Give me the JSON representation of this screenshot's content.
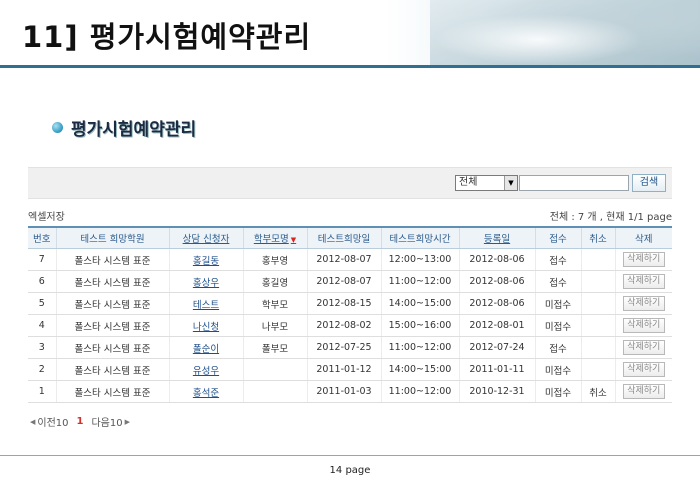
{
  "slide": {
    "title": "11] 평가시험예약관리",
    "section_title": "평가시험예약관리",
    "footer": "14 page"
  },
  "search": {
    "select_value": "전체",
    "input_value": "",
    "button_label": "검색"
  },
  "meta": {
    "excel_label": "엑셀저장",
    "summary": "전체 : 7 개  ,  현재 1/1 page"
  },
  "table": {
    "headers": [
      "번호",
      "테스트 희망학원",
      "상담 신청자",
      "학부모명",
      "테스트희망일",
      "테스트희망시간",
      "등록일",
      "접수",
      "취소",
      "삭제"
    ],
    "sort_icon": "▼",
    "delete_label": "삭제하기",
    "rows": [
      {
        "no": "7",
        "academy": "폴스타 시스템 표준",
        "applicant": "홍길동",
        "parent": "홍부영",
        "date": "2012-08-07",
        "time": "12:00~13:00",
        "reg": "2012-08-06",
        "status": "접수",
        "cancel": ""
      },
      {
        "no": "6",
        "academy": "폴스타 시스템 표준",
        "applicant": "홍상우",
        "parent": "홍길영",
        "date": "2012-08-07",
        "time": "11:00~12:00",
        "reg": "2012-08-06",
        "status": "접수",
        "cancel": ""
      },
      {
        "no": "5",
        "academy": "폴스타 시스템 표준",
        "applicant": "테스트",
        "parent": "학부모",
        "date": "2012-08-15",
        "time": "14:00~15:00",
        "reg": "2012-08-06",
        "status": "미접수",
        "cancel": ""
      },
      {
        "no": "4",
        "academy": "폴스타 시스템 표준",
        "applicant": "나신청",
        "parent": "나부모",
        "date": "2012-08-02",
        "time": "15:00~16:00",
        "reg": "2012-08-01",
        "status": "미접수",
        "cancel": ""
      },
      {
        "no": "3",
        "academy": "폴스타 시스템 표준",
        "applicant": "폴순이",
        "parent": "폴부모",
        "date": "2012-07-25",
        "time": "11:00~12:00",
        "reg": "2012-07-24",
        "status": "접수",
        "cancel": ""
      },
      {
        "no": "2",
        "academy": "폴스타 시스템 표준",
        "applicant": "유성우",
        "parent": "",
        "date": "2011-01-12",
        "time": "14:00~15:00",
        "reg": "2011-01-11",
        "status": "미접수",
        "cancel": ""
      },
      {
        "no": "1",
        "academy": "폴스타 시스템 표준",
        "applicant": "홍석준",
        "parent": "",
        "date": "2011-01-03",
        "time": "11:00~12:00",
        "reg": "2010-12-31",
        "status": "미접수",
        "cancel": "취소"
      }
    ]
  },
  "pager": {
    "prev_label": "이전10",
    "current_page": "1",
    "next_label": "다음10"
  }
}
